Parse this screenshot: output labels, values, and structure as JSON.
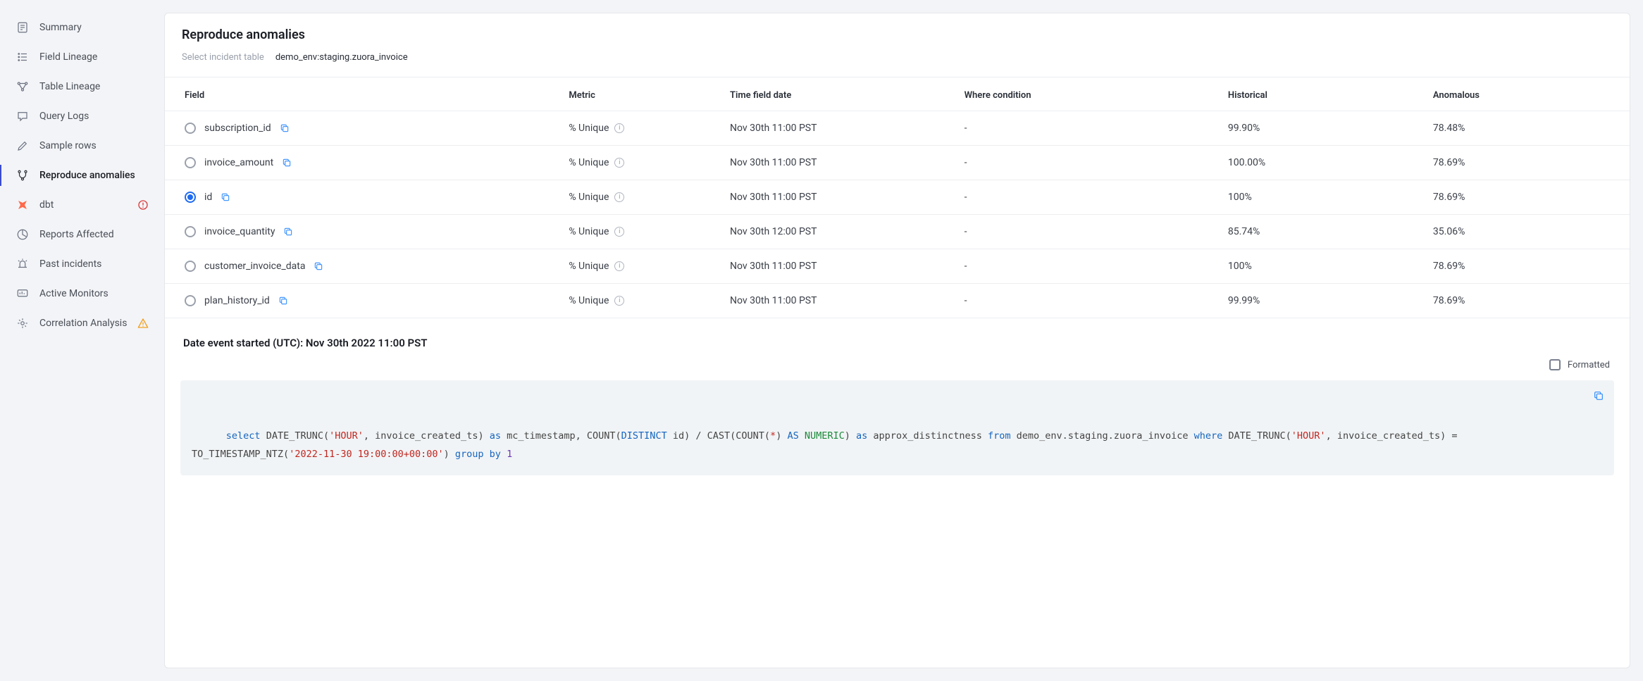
{
  "sidebar": {
    "items": [
      {
        "label": "Summary",
        "name": "summary"
      },
      {
        "label": "Field Lineage",
        "name": "field-lineage"
      },
      {
        "label": "Table Lineage",
        "name": "table-lineage"
      },
      {
        "label": "Query Logs",
        "name": "query-logs"
      },
      {
        "label": "Sample rows",
        "name": "sample-rows"
      },
      {
        "label": "Reproduce anomalies",
        "name": "reproduce-anomalies"
      },
      {
        "label": "dbt",
        "name": "dbt"
      },
      {
        "label": "Reports Affected",
        "name": "reports-affected"
      },
      {
        "label": "Past incidents",
        "name": "past-incidents"
      },
      {
        "label": "Active Monitors",
        "name": "active-monitors"
      },
      {
        "label": "Correlation Analysis",
        "name": "correlation-analysis"
      }
    ]
  },
  "page": {
    "title": "Reproduce anomalies",
    "select_label": "Select incident table",
    "table_ref": "demo_env:staging.zuora_invoice"
  },
  "tableHeaders": {
    "field": "Field",
    "metric": "Metric",
    "time": "Time field date",
    "where": "Where condition",
    "historical": "Historical",
    "anomalous": "Anomalous"
  },
  "rows": [
    {
      "field": "subscription_id",
      "metric": "% Unique",
      "time": "Nov 30th 11:00 PST",
      "where": "-",
      "historical": "99.90%",
      "anomalous": "78.48%",
      "selected": false
    },
    {
      "field": "invoice_amount",
      "metric": "% Unique",
      "time": "Nov 30th 11:00 PST",
      "where": "-",
      "historical": "100.00%",
      "anomalous": "78.69%",
      "selected": false
    },
    {
      "field": "id",
      "metric": "% Unique",
      "time": "Nov 30th 11:00 PST",
      "where": "-",
      "historical": "100%",
      "anomalous": "78.69%",
      "selected": true
    },
    {
      "field": "invoice_quantity",
      "metric": "% Unique",
      "time": "Nov 30th 12:00 PST",
      "where": "-",
      "historical": "85.74%",
      "anomalous": "35.06%",
      "selected": false
    },
    {
      "field": "customer_invoice_data",
      "metric": "% Unique",
      "time": "Nov 30th 11:00 PST",
      "where": "-",
      "historical": "100%",
      "anomalous": "78.69%",
      "selected": false
    },
    {
      "field": "plan_history_id",
      "metric": "% Unique",
      "time": "Nov 30th 11:00 PST",
      "where": "-",
      "historical": "99.99%",
      "anomalous": "78.69%",
      "selected": false
    }
  ],
  "event": {
    "label": "Date event started (UTC): Nov 30th 2022 11:00 PST"
  },
  "formatted": {
    "label": "Formatted"
  },
  "sql": {
    "tokens": [
      {
        "t": "select ",
        "c": "kw"
      },
      {
        "t": "DATE_TRUNC",
        "c": "fn"
      },
      {
        "t": "("
      },
      {
        "t": "'HOUR'",
        "c": "str"
      },
      {
        "t": ", invoice_created_ts) "
      },
      {
        "t": "as",
        "c": "kw"
      },
      {
        "t": " mc_timestamp, "
      },
      {
        "t": "COUNT",
        "c": "fn"
      },
      {
        "t": "("
      },
      {
        "t": "DISTINCT",
        "c": "kw"
      },
      {
        "t": " id) / "
      },
      {
        "t": "CAST",
        "c": "fn"
      },
      {
        "t": "("
      },
      {
        "t": "COUNT",
        "c": "fn"
      },
      {
        "t": "("
      },
      {
        "t": "*",
        "c": "star"
      },
      {
        "t": ") "
      },
      {
        "t": "AS",
        "c": "kw"
      },
      {
        "t": " "
      },
      {
        "t": "NUMERIC",
        "c": "typ"
      },
      {
        "t": ") "
      },
      {
        "t": "as",
        "c": "kw"
      },
      {
        "t": " approx_distinctness "
      },
      {
        "t": "from",
        "c": "kw"
      },
      {
        "t": " demo_env.staging.zuora_invoice "
      },
      {
        "t": "where",
        "c": "kw"
      },
      {
        "t": " "
      },
      {
        "t": "DATE_TRUNC",
        "c": "fn"
      },
      {
        "t": "("
      },
      {
        "t": "'HOUR'",
        "c": "str"
      },
      {
        "t": ", invoice_created_ts) = "
      },
      {
        "t": "TO_TIMESTAMP_NTZ",
        "c": "fn"
      },
      {
        "t": "("
      },
      {
        "t": "'2022-11-30 19:00:00+00:00'",
        "c": "str"
      },
      {
        "t": ") "
      },
      {
        "t": "group by",
        "c": "kw"
      },
      {
        "t": " "
      },
      {
        "t": "1",
        "c": "num"
      }
    ]
  }
}
